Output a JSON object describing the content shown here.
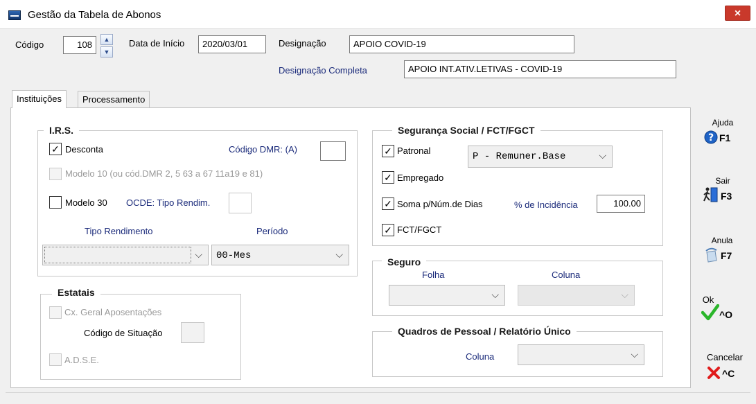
{
  "window": {
    "title": "Gestão da Tabela de Abonos",
    "close_glyph": "×"
  },
  "header": {
    "codigo_label": "Código",
    "codigo_value": "108",
    "data_inicio_label": "Data de Início",
    "data_inicio_value": "2020/03/01",
    "designacao_label": "Designação",
    "designacao_value": "APOIO COVID-19",
    "designacao_completa_label": "Designação Completa",
    "designacao_completa_value": "APOIO INT.ATIV.LETIVAS - COVID-19"
  },
  "tabs": [
    {
      "label": "Instituições",
      "active": true
    },
    {
      "label": "Processamento",
      "active": false
    }
  ],
  "irs": {
    "title": "I.R.S.",
    "desconta_label": "Desconta",
    "desconta_checked": true,
    "codigo_dmr_label": "Código DMR:  (A)",
    "codigo_dmr_value": "",
    "modelo10_label": "Modelo 10 (ou cód.DMR 2, 5  63 a 67  11a19  e 81)",
    "modelo10_checked": false,
    "modelo30_label": "Modelo 30",
    "modelo30_checked": false,
    "ocde_label": "OCDE: Tipo Rendim.",
    "ocde_value": "",
    "tipo_rendimento_label": "Tipo Rendimento",
    "tipo_rendimento_value": "",
    "periodo_label": "Período",
    "periodo_value": "00-Mes"
  },
  "estatais": {
    "title": "Estatais",
    "cx_geral_label": "Cx. Geral  Aposentações",
    "cx_geral_checked": false,
    "codigo_situacao_label": "Código de Situação",
    "codigo_situacao_value": "",
    "adse_label": "A.D.S.E.",
    "adse_checked": false
  },
  "seguranca_social": {
    "title": "Segurança Social   /   FCT/FGCT",
    "patronal_label": "Patronal",
    "patronal_checked": true,
    "patronal_select_value": "P - Remuner.Base",
    "empregado_label": "Empregado",
    "empregado_checked": true,
    "soma_label": "Soma p/Núm.de Dias",
    "soma_checked": true,
    "incidencia_label": "% de Incidência",
    "incidencia_value": "100.00",
    "fct_label": "FCT/FGCT",
    "fct_checked": true
  },
  "seguro": {
    "title": "Seguro",
    "folha_label": "Folha",
    "folha_value": "",
    "coluna_label": "Coluna",
    "coluna_value": ""
  },
  "quadros": {
    "title": "Quadros de Pessoal / Relatório Único",
    "coluna_label": "Coluna",
    "coluna_value": ""
  },
  "actions": {
    "ajuda_label": "Ajuda",
    "ajuda_key": "F1",
    "sair_label": "Sair",
    "sair_key": "F3",
    "anula_label": "Anula",
    "anula_key": "F7",
    "ok_label": "Ok",
    "ok_key": "^O",
    "cancelar_label": "Cancelar",
    "cancelar_key": "^C"
  },
  "colors": {
    "ok_green": "#2bb62b",
    "cancel_red": "#e01b1b",
    "help_blue": "#1f63c6",
    "title_close": "#c9392b"
  },
  "icons": {
    "ajuda": "help-icon",
    "sair": "exit-icon",
    "anula": "eraser-icon",
    "ok": "checkmark-icon",
    "cancelar": "x-icon"
  }
}
